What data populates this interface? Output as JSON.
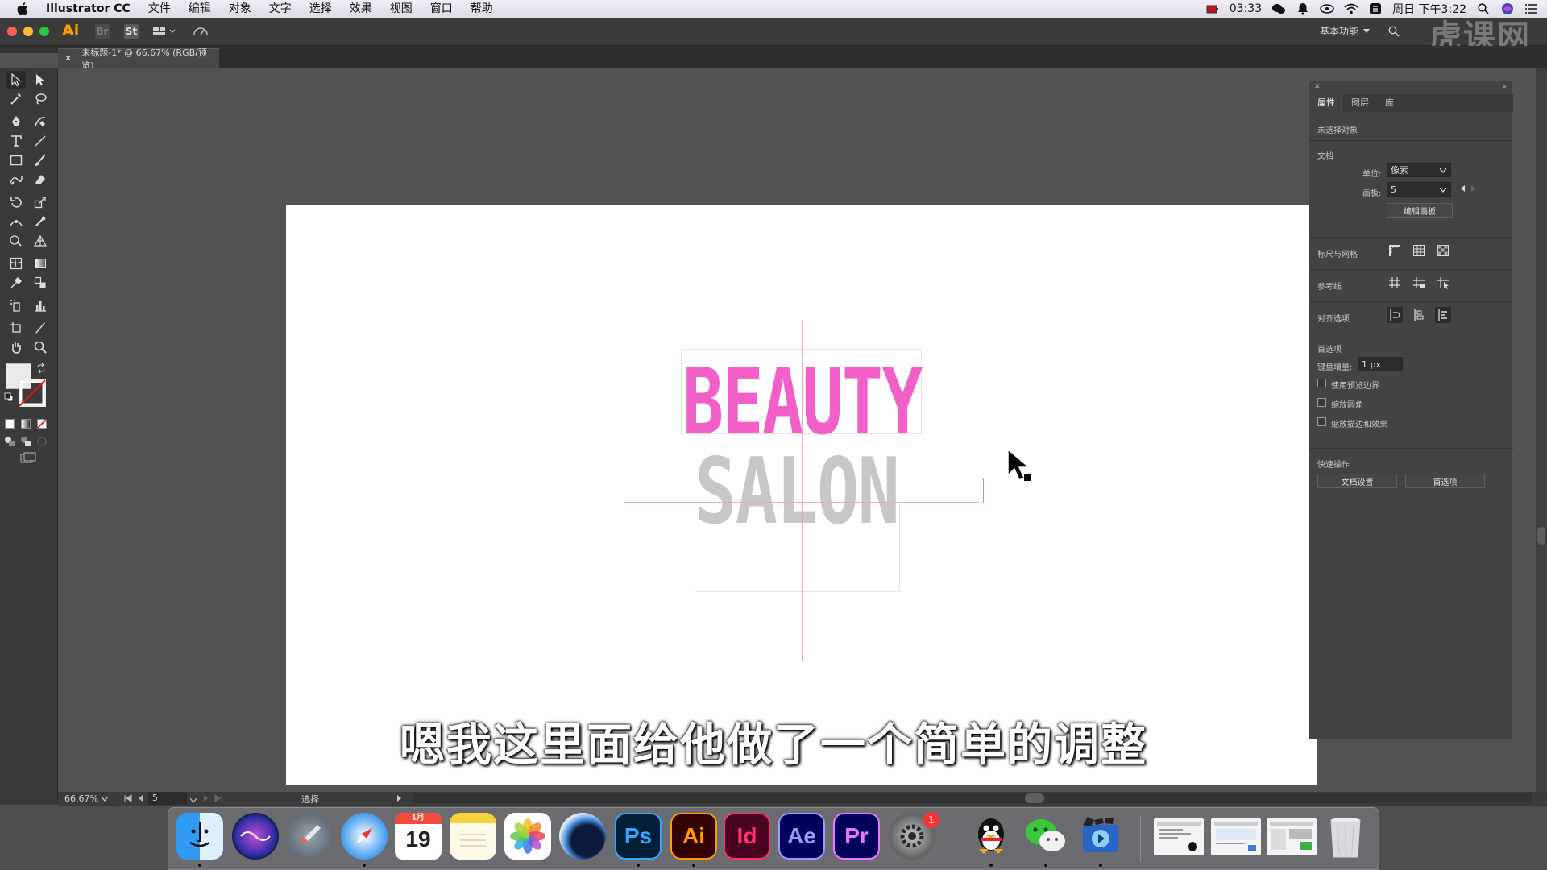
{
  "menubar": {
    "app_name": "Illustrator CC",
    "items": [
      "文件",
      "编辑",
      "对象",
      "文字",
      "选择",
      "效果",
      "视图",
      "窗口",
      "帮助"
    ],
    "battery_time": "03:33",
    "clock": "周日 下午3:22"
  },
  "appbar": {
    "logo": "Ai",
    "bridge_label": "Br",
    "stock_label": "St",
    "workspace": "基本功能",
    "watermark": "虎课网"
  },
  "document_tab": {
    "title": "未标题-1* @ 66.67% (RGB/预览)"
  },
  "artwork": {
    "line1": "BEAUTY",
    "line2": "SALON",
    "line1_color": "#f35fc8",
    "line2_color": "#c7c7c7"
  },
  "subtitle": "嗯我这里面给他做了一个简单的调整",
  "properties_panel": {
    "tabs": [
      "属性",
      "图层",
      "库"
    ],
    "no_selection": "未选择对象",
    "document_section": "文档",
    "units_label": "单位:",
    "units_value": "像素",
    "artboard_label": "画板:",
    "artboard_value": "5",
    "edit_artboards_button": "编辑画板",
    "rulers_grid_label": "标尺与网格",
    "guides_label": "参考线",
    "snap_label": "对齐选项",
    "preferences_section": "首选项",
    "keyboard_increment_label": "键盘增量:",
    "keyboard_increment_value": "1 px",
    "checkboxes": [
      "使用预览边界",
      "缩放圆角",
      "缩放描边和效果"
    ],
    "quick_actions_label": "快速操作",
    "doc_setup_button": "文档设置",
    "preferences_button": "首选项"
  },
  "statusbar": {
    "zoom": "66.67%",
    "artboard_num": "5",
    "tool_status": "选择"
  },
  "dock": {
    "calendar_month": "1月",
    "calendar_day": "19",
    "ps": "Ps",
    "ai": "Ai",
    "id": "Id",
    "ae": "Ae",
    "pr": "Pr",
    "settings_badge": "1"
  },
  "colors": {
    "accent_pink": "#f35fc8",
    "gray_text": "#c7c7c7",
    "guide_pink": "#e8aac0"
  }
}
